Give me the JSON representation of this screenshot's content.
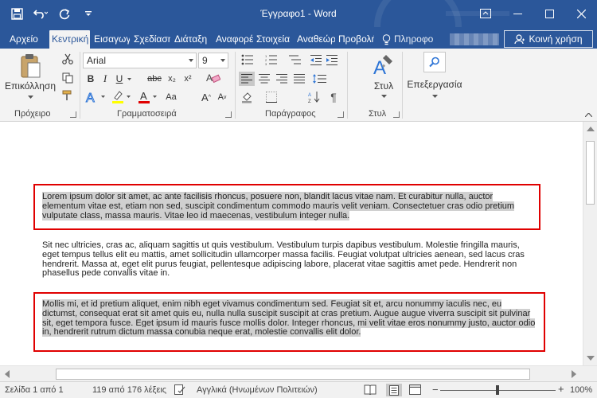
{
  "window": {
    "title": "Έγγραφο1 - Word",
    "minimize": "—",
    "restore": "▭",
    "close": "✕"
  },
  "tabs": [
    {
      "label": "Αρχείο",
      "active": false
    },
    {
      "label": "Κεντρική",
      "active": true
    },
    {
      "label": "Εισαγωγή",
      "active": false
    },
    {
      "label": "Σχεδίαση",
      "active": false
    },
    {
      "label": "Διάταξη",
      "active": false
    },
    {
      "label": "Αναφορές",
      "active": false
    },
    {
      "label": "Στοιχεία",
      "active": false
    },
    {
      "label": "Αναθεώρηση",
      "active": false
    },
    {
      "label": "Προβολή",
      "active": false
    }
  ],
  "tell_me": {
    "label": "Πληροφο"
  },
  "share": {
    "label": "Κοινή χρήση"
  },
  "ribbon": {
    "clipboard": {
      "paste_label": "Επικόλληση",
      "group_label": "Πρόχειρο"
    },
    "font": {
      "name": "Arial",
      "size": "9",
      "group_label": "Γραμματοσειρά",
      "bold": "B",
      "italic": "I",
      "underline": "U",
      "strike": "abc",
      "subscript": "x₂",
      "superscript": "x²",
      "grow": "A",
      "shrink": "A",
      "case": "Aa"
    },
    "paragraph": {
      "group_label": "Παράγραφος"
    },
    "styles": {
      "label": "Στυλ",
      "group_label": "Στυλ"
    },
    "editing": {
      "label": "Επεξεργασία"
    }
  },
  "document": {
    "paragraphs": [
      {
        "text": "Lorem ipsum dolor sit amet, ac ante facilisis rhoncus, posuere non, blandit lacus vitae nam. Et curabitur nulla, auctor elementum vitae est, etiam non sed, suscipit condimentum commodo mauris velit veniam. Consectetuer cras odio pretium vulputate class, massa mauris. Vitae leo id maecenas, vestibulum integer nulla.",
        "selected": true,
        "boxed": true
      },
      {
        "text": "Sit nec ultricies, cras ac, aliquam sagittis ut quis vestibulum. Vestibulum turpis dapibus vestibulum. Molestie fringilla mauris, eget tempus tellus elit eu mattis, amet sollicitudin ullamcorper massa facilis. Feugiat volutpat ultricies aenean, sed lacus cras hendrerit. Massa at, eget elit purus feugiat, pellentesque adipiscing labore, placerat vitae sagittis amet pede. Hendrerit non phasellus pede convallis vitae in.",
        "selected": false,
        "boxed": false
      },
      {
        "text": "Mollis mi, et id pretium aliquet, enim nibh eget vivamus condimentum sed. Feugiat sit et, arcu nonummy iaculis nec, eu dictumst, consequat erat sit amet quis eu, nulla nulla suscipit suscipit at cras pretium. Augue augue viverra suscipit sit pulvinar sit, eget tempora fusce. Eget ipsum id mauris fusce mollis dolor. Integer rhoncus, mi velit vitae eros nonummy justo, auctor odio in, hendrerit rutrum dictum massa conubia neque erat, molestie convallis elit dolor.",
        "selected": true,
        "boxed": true
      }
    ]
  },
  "status": {
    "page": "Σελίδα 1 από 1",
    "words": "119 από 176 λέξεις",
    "language": "Αγγλικά (Ηνωμένων Πολιτειών)",
    "zoom": "100%"
  },
  "colors": {
    "brand": "#2b579a",
    "selection": "#d0d0d0",
    "annotation": "#e00000"
  }
}
